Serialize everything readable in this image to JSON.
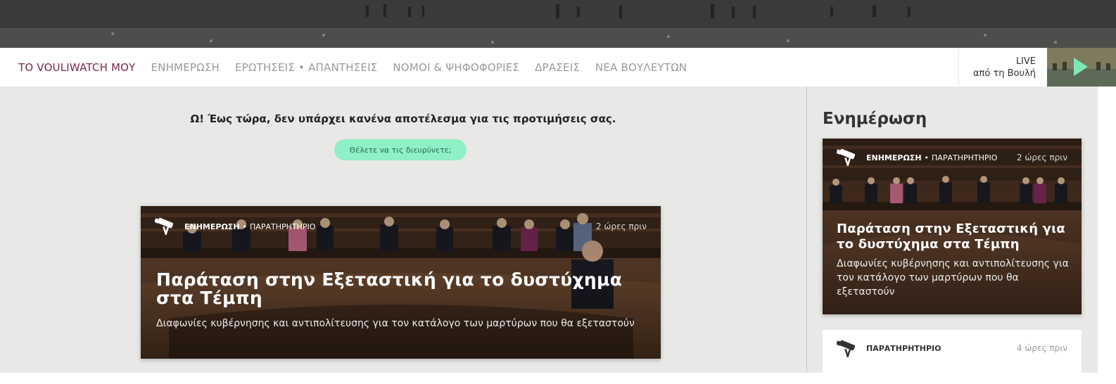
{
  "nav": {
    "items": [
      {
        "label": "ΤΟ VOULIWATCH ΜΟΥ",
        "active": true
      },
      {
        "label": "ΕΝΗΜΕΡΩΣΗ",
        "active": false
      },
      {
        "label": "ΕΡΩΤΗΣΕΙΣ • ΑΠΑΝΤΗΣΕΙΣ",
        "active": false
      },
      {
        "label": "ΝΟΜΟΙ & ΨΗΦΟΦΟΡΙΕΣ",
        "active": false
      },
      {
        "label": "ΔΡΑΣΕΙΣ",
        "active": false
      },
      {
        "label": "ΝΕΑ ΒΟΥΛΕΥΤΩΝ",
        "active": false
      }
    ],
    "live": {
      "line1": "LIVE",
      "line2": "από τη Βουλή",
      "icon": "play-icon"
    }
  },
  "main": {
    "empty_message": "Ω! Έως τώρα, δεν υπάρχει κανένα αποτέλεσμα για τις προτιμήσεις σας.",
    "expand_button": "Θέλετε να τις διευρύνετε;",
    "featured": {
      "icon": "telescope-icon",
      "category": "ΕΝΗΜΕΡΩΣΗ",
      "separator": "•",
      "subcategory": "ΠΑΡΑΤΗΡΗΤΗΡΙΟ",
      "time": "2 ώρες πριν",
      "title": "Παράταση στην Εξεταστική για το δυστύχημα στα Τέμπη",
      "description": "Διαφωνίες κυβέρνησης και αντιπολίτευσης για τον κατάλογο των μαρτύρων που θα εξεταστούν"
    }
  },
  "sidebar": {
    "title": "Ενημέρωση",
    "card": {
      "icon": "telescope-icon",
      "category": "ΕΝΗΜΕΡΩΣΗ",
      "separator": "•",
      "subcategory": "ΠΑΡΑΤΗΡΗΤΗΡΙΟ",
      "time": "2 ώρες πριν",
      "title": "Παράταση στην Εξεταστική για το δυστύχημα στα Τέμπη",
      "description": "Διαφωνίες κυβέρνησης και αντιπολίτευσης για τον κατάλογο των μαρτύρων που θα εξεταστούν"
    },
    "small_card": {
      "icon": "telescope-icon",
      "category": "ΠΑΡΑΤΗΡΗΤΗΡΙΟ",
      "time": "4 ώρες πριν"
    }
  },
  "colors": {
    "accent": "#7a2843",
    "pill": "#8ef0c4",
    "background": "#e8e8e6"
  }
}
